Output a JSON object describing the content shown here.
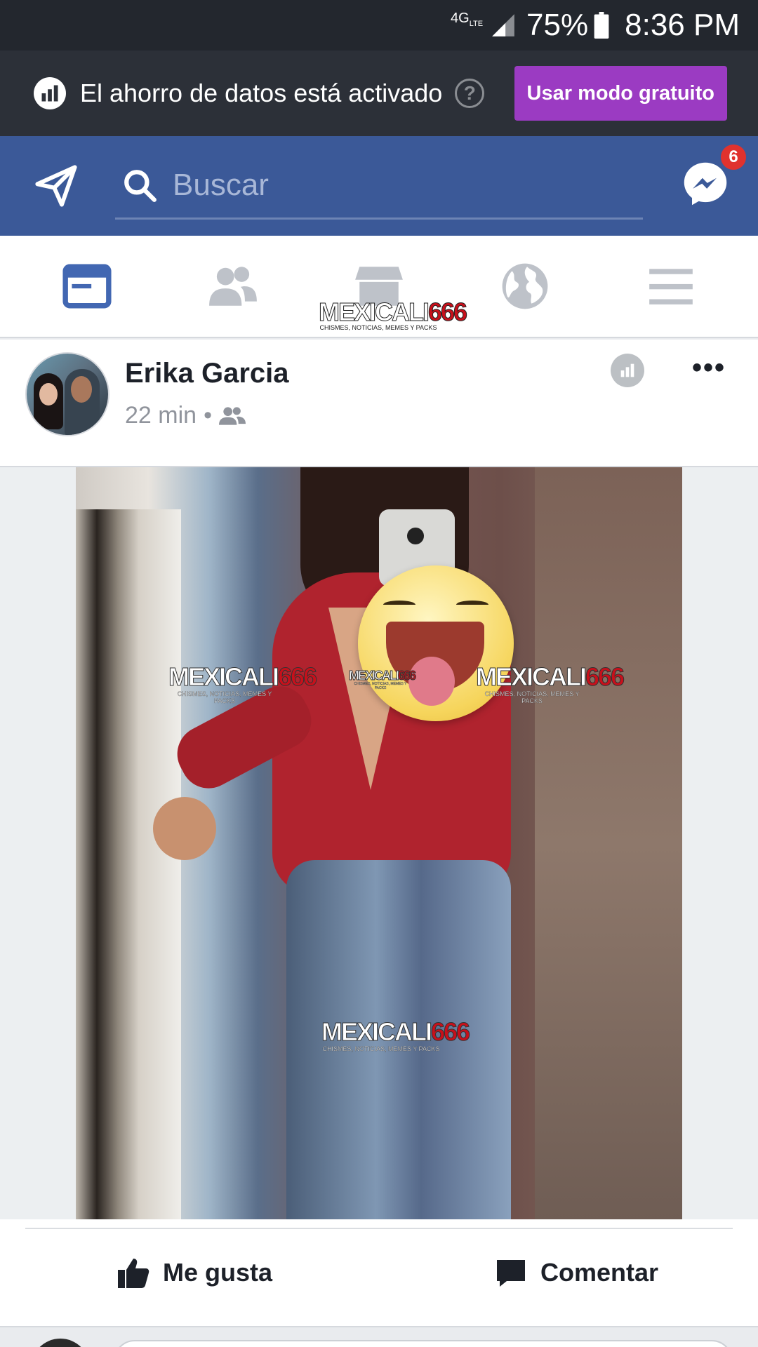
{
  "status_bar": {
    "network": "4G",
    "network_sub": "LTE",
    "battery_pct": "75%",
    "time": "8:36 PM"
  },
  "data_saver_banner": {
    "text": "El ahorro de datos está activado",
    "help": "?",
    "button": "Usar modo gratuito"
  },
  "top_bar": {
    "search_placeholder": "Buscar",
    "messenger_badge": "6"
  },
  "tabs": [
    {
      "name": "news-feed",
      "icon": "news-feed-icon",
      "active": true
    },
    {
      "name": "friends",
      "icon": "friends-icon"
    },
    {
      "name": "marketplace",
      "icon": "marketplace-icon"
    },
    {
      "name": "notifications",
      "icon": "globe-icon"
    },
    {
      "name": "menu",
      "icon": "hamburger-icon"
    }
  ],
  "logo_watermark": {
    "main_a": "MEXICALI",
    "main_b": "666",
    "sub": "CHISMES, NOTICIAS, MEMES Y PACKS"
  },
  "post": {
    "author": "Erika Garcia",
    "time": "22 min",
    "separator": "•",
    "more": "•••",
    "watermarks": [
      {
        "main_a": "MEXICALI",
        "main_b": "666",
        "sub": "CHISMES, NOTICIAS, MEMES Y PACKS"
      },
      {
        "main_a": "MEXICALI",
        "main_b": "666",
        "sub": "CHISMES, NOTICIAS, MEMES Y PACKS"
      },
      {
        "main_a": "MEXICALI",
        "main_b": "666",
        "sub": "CHISMES, NOTICIAS, MEMES Y PACKS"
      },
      {
        "main_a": "MEXICALI",
        "main_b": "666",
        "sub": "CHISMES, NOTICIAS, MEMES Y PACKS"
      }
    ]
  },
  "actions": {
    "like": "Me gusta",
    "comment": "Comentar"
  },
  "colors": {
    "facebook_blue": "#3b5998",
    "free_mode_purple": "#9b3bc2",
    "badge_red": "#e0322e"
  }
}
